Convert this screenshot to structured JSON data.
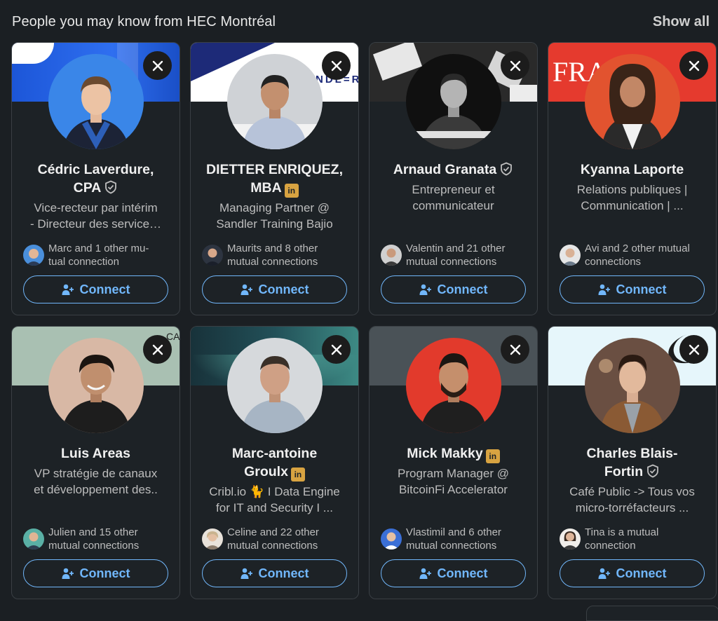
{
  "header": {
    "title": "People you may know from HEC Montréal",
    "show_all": "Show all"
  },
  "connect_label": "Connect",
  "colors": {
    "accent": "#71b7fb",
    "background": "#1b1f23",
    "card": "#1d2226",
    "premium": "#d8a341"
  },
  "cards": [
    {
      "name_lines": [
        "Cédric Laverdure,",
        "CPA"
      ],
      "badge": "verified",
      "headline": [
        "Vice-recteur par intérim",
        "- Directeur des service…"
      ],
      "mutual": [
        "Marc and 1 other mu-",
        "tual connection"
      ]
    },
    {
      "name_lines": [
        "DIETTER ENRIQUEZ,",
        "MBA"
      ],
      "badge": "in",
      "banner_text": "NDL=R",
      "headline": [
        "Managing Partner @",
        "Sandler Training Bajio"
      ],
      "mutual": [
        "Maurits and 8 other",
        "mutual connections"
      ]
    },
    {
      "name_lines": [
        "Arnaud Granata"
      ],
      "badge": "verified",
      "headline": [
        "Entrepreneur et",
        "communicateur"
      ],
      "mutual": [
        "Valentin and 21 other",
        "mutual connections"
      ]
    },
    {
      "name_lines": [
        "Kyanna Laporte"
      ],
      "badge": "",
      "banner_text": "FRA",
      "headline": [
        "Relations publiques |",
        "Communication | ..."
      ],
      "mutual": [
        "Avi and 2 other mutual",
        "connections"
      ]
    },
    {
      "name_lines": [
        "Luis Areas"
      ],
      "badge": "",
      "banner_text": "CA",
      "headline": [
        "VP stratégie de canaux",
        "et développement des.."
      ],
      "mutual": [
        "Julien and 15 other",
        "mutual connections"
      ]
    },
    {
      "name_lines": [
        "Marc-antoine",
        "Groulx"
      ],
      "badge": "in",
      "headline": [
        "Cribl.io 🐈 I Data Engine",
        "for IT and Security I ..."
      ],
      "mutual": [
        "Celine and 22 other",
        "mutual connections"
      ]
    },
    {
      "name_lines": [
        "Mick Makky"
      ],
      "badge": "in",
      "headline": [
        "Program Manager @",
        "BitcoinFi Accelerator"
      ],
      "mutual": [
        "Vlastimil and 6 other",
        "mutual connections"
      ]
    },
    {
      "name_lines": [
        "Charles Blais-",
        "Fortin"
      ],
      "badge": "verified",
      "headline": [
        "Café Public -> Tous vos",
        "micro-torréfacteurs ..."
      ],
      "mutual": [
        "Tina is a mutual",
        "connection"
      ]
    }
  ]
}
